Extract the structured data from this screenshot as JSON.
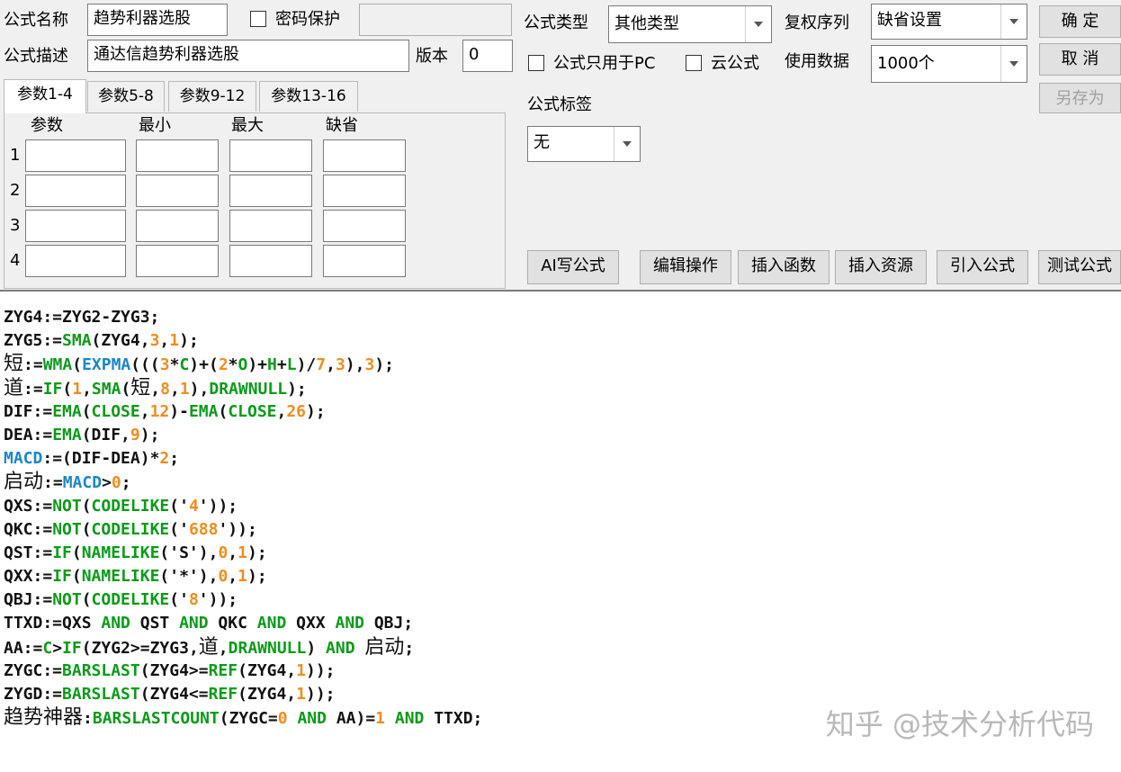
{
  "header": {
    "formula_name_label": "公式名称",
    "formula_name_value": "趋势利器选股",
    "password_label": "密码保护",
    "formula_desc_label": "公式描述",
    "formula_desc_value": "通达信趋势利器选股",
    "version_label": "版本",
    "version_value": "0",
    "formula_type_label": "公式类型",
    "formula_type_value": "其他类型",
    "rights_label": "复权序列",
    "rights_value": "缺省设置",
    "pc_only_label": "公式只用于PC",
    "cloud_label": "云公式",
    "use_data_label": "使用数据",
    "use_data_value": "1000个",
    "tag_label": "公式标签",
    "tag_value": "无"
  },
  "buttons": {
    "ok": "确 定",
    "cancel": "取 消",
    "save_as": "另存为",
    "ai": "AI写公式",
    "edit_ops": "编辑操作",
    "insert_func": "插入函数",
    "insert_res": "插入资源",
    "import_formula": "引入公式",
    "test_formula": "测试公式"
  },
  "params": {
    "tabs": [
      "参数1-4",
      "参数5-8",
      "参数9-12",
      "参数13-16"
    ],
    "columns": [
      "参数",
      "最小",
      "最大",
      "缺省"
    ],
    "rows": [
      "1",
      "2",
      "3",
      "4"
    ]
  },
  "code": {
    "lines": [
      [
        {
          "t": "ZYG4:=ZYG2-ZYG3;"
        }
      ],
      [
        {
          "t": "ZYG5:="
        },
        {
          "t": "SMA",
          "c": "g"
        },
        {
          "t": "(ZYG4,"
        },
        {
          "t": "3",
          "c": "o"
        },
        {
          "t": ","
        },
        {
          "t": "1",
          "c": "o"
        },
        {
          "t": ");"
        }
      ],
      [
        {
          "t": "短",
          "c": "cjk"
        },
        {
          "t": ":="
        },
        {
          "t": "WMA",
          "c": "g"
        },
        {
          "t": "("
        },
        {
          "t": "EXPMA",
          "c": "b"
        },
        {
          "t": "((("
        },
        {
          "t": "3",
          "c": "o"
        },
        {
          "t": "*"
        },
        {
          "t": "C",
          "c": "g"
        },
        {
          "t": ")+("
        },
        {
          "t": "2",
          "c": "o"
        },
        {
          "t": "*"
        },
        {
          "t": "O",
          "c": "g"
        },
        {
          "t": ")+"
        },
        {
          "t": "H",
          "c": "g"
        },
        {
          "t": "+"
        },
        {
          "t": "L",
          "c": "g"
        },
        {
          "t": ")/"
        },
        {
          "t": "7",
          "c": "o"
        },
        {
          "t": ","
        },
        {
          "t": "3",
          "c": "o"
        },
        {
          "t": "),"
        },
        {
          "t": "3",
          "c": "o"
        },
        {
          "t": ");"
        }
      ],
      [
        {
          "t": "道",
          "c": "cjk"
        },
        {
          "t": ":="
        },
        {
          "t": "IF",
          "c": "g"
        },
        {
          "t": "("
        },
        {
          "t": "1",
          "c": "o"
        },
        {
          "t": ","
        },
        {
          "t": "SMA",
          "c": "g"
        },
        {
          "t": "("
        },
        {
          "t": "短",
          "c": "cjk"
        },
        {
          "t": ","
        },
        {
          "t": "8",
          "c": "o"
        },
        {
          "t": ","
        },
        {
          "t": "1",
          "c": "o"
        },
        {
          "t": "),"
        },
        {
          "t": "DRAWNULL",
          "c": "g"
        },
        {
          "t": ");"
        }
      ],
      [
        {
          "t": "DIF:="
        },
        {
          "t": "EMA",
          "c": "g"
        },
        {
          "t": "("
        },
        {
          "t": "CLOSE",
          "c": "g"
        },
        {
          "t": ","
        },
        {
          "t": "12",
          "c": "o"
        },
        {
          "t": ")-"
        },
        {
          "t": "EMA",
          "c": "g"
        },
        {
          "t": "("
        },
        {
          "t": "CLOSE",
          "c": "g"
        },
        {
          "t": ","
        },
        {
          "t": "26",
          "c": "o"
        },
        {
          "t": ");"
        }
      ],
      [
        {
          "t": "DEA:="
        },
        {
          "t": "EMA",
          "c": "g"
        },
        {
          "t": "(DIF,"
        },
        {
          "t": "9",
          "c": "o"
        },
        {
          "t": ");"
        }
      ],
      [
        {
          "t": "MACD",
          "c": "b"
        },
        {
          "t": ":=(DIF-DEA)*"
        },
        {
          "t": "2",
          "c": "o"
        },
        {
          "t": ";"
        }
      ],
      [
        {
          "t": "启动",
          "c": "cjk"
        },
        {
          "t": ":="
        },
        {
          "t": "MACD",
          "c": "b"
        },
        {
          "t": ">"
        },
        {
          "t": "0",
          "c": "o"
        },
        {
          "t": ";"
        }
      ],
      [
        {
          "t": "QXS:="
        },
        {
          "t": "NOT",
          "c": "g"
        },
        {
          "t": "("
        },
        {
          "t": "CODELIKE",
          "c": "g"
        },
        {
          "t": "('"
        },
        {
          "t": "4",
          "c": "o"
        },
        {
          "t": "'));"
        }
      ],
      [
        {
          "t": "QKC:="
        },
        {
          "t": "NOT",
          "c": "g"
        },
        {
          "t": "("
        },
        {
          "t": "CODELIKE",
          "c": "g"
        },
        {
          "t": "('"
        },
        {
          "t": "688",
          "c": "o"
        },
        {
          "t": "'));"
        }
      ],
      [
        {
          "t": "QST:="
        },
        {
          "t": "IF",
          "c": "g"
        },
        {
          "t": "("
        },
        {
          "t": "NAMELIKE",
          "c": "g"
        },
        {
          "t": "('S'),"
        },
        {
          "t": "0",
          "c": "o"
        },
        {
          "t": ","
        },
        {
          "t": "1",
          "c": "o"
        },
        {
          "t": ");"
        }
      ],
      [
        {
          "t": "QXX:="
        },
        {
          "t": "IF",
          "c": "g"
        },
        {
          "t": "("
        },
        {
          "t": "NAMELIKE",
          "c": "g"
        },
        {
          "t": "('*'),"
        },
        {
          "t": "0",
          "c": "o"
        },
        {
          "t": ","
        },
        {
          "t": "1",
          "c": "o"
        },
        {
          "t": ");"
        }
      ],
      [
        {
          "t": "QBJ:="
        },
        {
          "t": "NOT",
          "c": "g"
        },
        {
          "t": "("
        },
        {
          "t": "CODELIKE",
          "c": "g"
        },
        {
          "t": "('"
        },
        {
          "t": "8",
          "c": "o"
        },
        {
          "t": "'));"
        }
      ],
      [
        {
          "t": "TTXD:=QXS "
        },
        {
          "t": "AND",
          "c": "g"
        },
        {
          "t": " QST "
        },
        {
          "t": "AND",
          "c": "g"
        },
        {
          "t": " QKC "
        },
        {
          "t": "AND",
          "c": "g"
        },
        {
          "t": " QXX "
        },
        {
          "t": "AND",
          "c": "g"
        },
        {
          "t": " QBJ;"
        }
      ],
      [
        {
          "t": "AA:="
        },
        {
          "t": "C",
          "c": "g"
        },
        {
          "t": ">"
        },
        {
          "t": "IF",
          "c": "g"
        },
        {
          "t": "(ZYG2>=ZYG3,"
        },
        {
          "t": "道",
          "c": "cjk"
        },
        {
          "t": ","
        },
        {
          "t": "DRAWNULL",
          "c": "g"
        },
        {
          "t": ") "
        },
        {
          "t": "AND",
          "c": "g"
        },
        {
          "t": " "
        },
        {
          "t": "启动",
          "c": "cjk"
        },
        {
          "t": ";"
        }
      ],
      [
        {
          "t": "ZYGC:="
        },
        {
          "t": "BARSLAST",
          "c": "g"
        },
        {
          "t": "(ZYG4>="
        },
        {
          "t": "REF",
          "c": "g"
        },
        {
          "t": "(ZYG4,"
        },
        {
          "t": "1",
          "c": "o"
        },
        {
          "t": "));"
        }
      ],
      [
        {
          "t": "ZYGD:="
        },
        {
          "t": "BARSLAST",
          "c": "g"
        },
        {
          "t": "(ZYG4<="
        },
        {
          "t": "REF",
          "c": "g"
        },
        {
          "t": "(ZYG4,"
        },
        {
          "t": "1",
          "c": "o"
        },
        {
          "t": "));"
        }
      ],
      [
        {
          "t": "趋势神器",
          "c": "cjk"
        },
        {
          "t": ":"
        },
        {
          "t": "BARSLASTCOUNT",
          "c": "g"
        },
        {
          "t": "(ZYGC="
        },
        {
          "t": "0",
          "c": "o"
        },
        {
          "t": " "
        },
        {
          "t": "AND",
          "c": "g"
        },
        {
          "t": " AA)="
        },
        {
          "t": "1",
          "c": "o"
        },
        {
          "t": " "
        },
        {
          "t": "AND",
          "c": "g"
        },
        {
          "t": " TTXD;"
        }
      ]
    ]
  },
  "watermark": "知乎 @技术分析代码",
  "colors": {
    "function": "#0a9a19",
    "keyword_blue": "#1a86c8",
    "number": "#f08d1d"
  }
}
